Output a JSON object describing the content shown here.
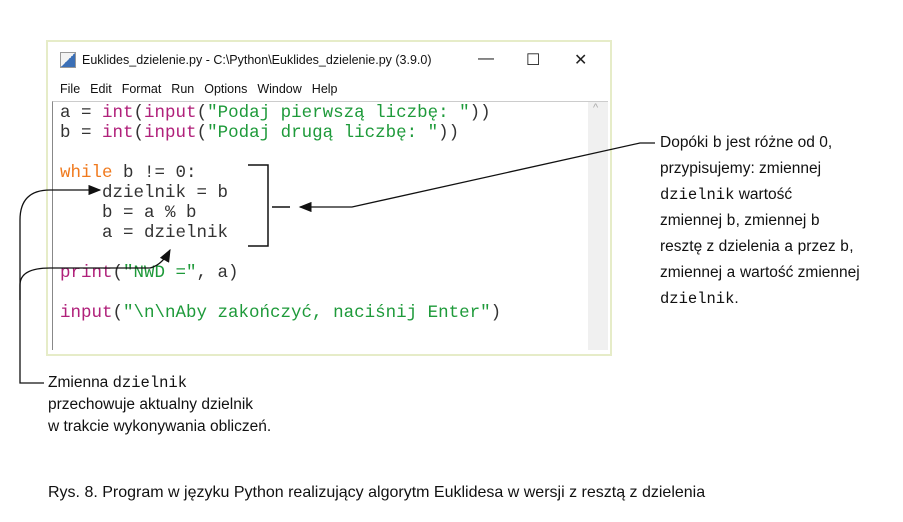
{
  "window": {
    "title": "Euklides_dzielenie.py - C:\\Python\\Euklides_dzielenie.py (3.9.0)",
    "minimize": "—",
    "maximize": "☐",
    "close": "✕",
    "menu": [
      "File",
      "Edit",
      "Format",
      "Run",
      "Options",
      "Window",
      "Help"
    ]
  },
  "code": {
    "l1": {
      "a": "a = ",
      "b": "int",
      "c": "(",
      "d": "input",
      "e": "(",
      "f": "\"Podaj pierwszą liczbę: \"",
      "g": "))"
    },
    "l2": {
      "a": "b = ",
      "b": "int",
      "c": "(",
      "d": "input",
      "e": "(",
      "f": "\"Podaj drugą liczbę: \"",
      "g": "))"
    },
    "l4": {
      "a": "while",
      "b": " b != 0:"
    },
    "l5": "    dzielnik = b",
    "l6": "    b = a % b",
    "l7": "    a = dzielnik",
    "l9": {
      "a": "print",
      "b": "(",
      "c": "\"NWD =\"",
      "d": ", a)"
    },
    "l11": {
      "a": "input",
      "b": "(",
      "c": "\"\\n\\nAby zakończyć, naciśnij Enter\"",
      "d": ")"
    }
  },
  "annotation_right": {
    "t1": "Dopóki ",
    "m1": "b",
    "t2": " jest różne od 0,",
    "t3": "przypisujemy: zmiennej",
    "m2": "dzielnik",
    "t4": " wartość",
    "t5": "zmiennej ",
    "m3": "b",
    "t6": ", zmiennej ",
    "m4": "b",
    "t7": "resztę z dzielenia ",
    "m5": "a",
    "t8": " przez ",
    "m6": "b",
    "t9": ",",
    "t10": "zmiennej ",
    "m7": "a",
    "t11": " wartość zmiennej",
    "m8": "dzielnik",
    "t12": "."
  },
  "annotation_left": {
    "t1": "Zmienna ",
    "m1": "dzielnik",
    "t2": "przechowuje aktualny dzielnik",
    "t3": "w trakcie wykonywania obliczeń."
  },
  "caption": "Rys. 8. Program w języku Python realizujący algorytm Euklidesa w wersji z resztą z dzielenia"
}
